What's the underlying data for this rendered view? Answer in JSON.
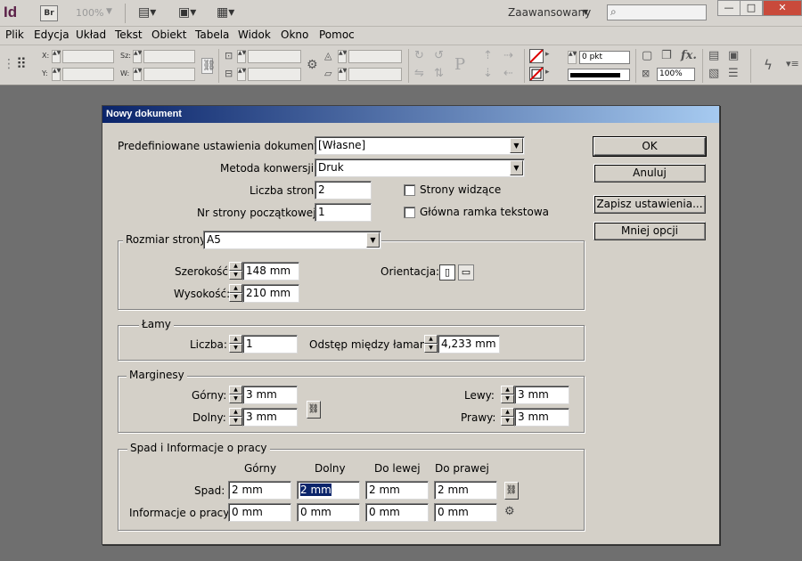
{
  "app": {
    "logo": "Id",
    "bridge": "Br",
    "zoom": "100%",
    "workspace": "Zaawansowany",
    "search_placeholder": "",
    "window_buttons": [
      "—",
      "□",
      "✕"
    ]
  },
  "menubar": [
    "Plik",
    "Edycja",
    "Układ",
    "Tekst",
    "Obiekt",
    "Tabela",
    "Widok",
    "Okno",
    "Pomoc"
  ],
  "control_panel": {
    "x_label": "X:",
    "y_label": "Y:",
    "w_label": "Sz:",
    "h_label": "W:",
    "stroke_weight": "0 pkt",
    "opacity": "100%"
  },
  "dialog": {
    "title": "Nowy dokument",
    "preset_label": "Predefiniowane ustawienia dokumentu:",
    "preset_value": "[Własne]",
    "conversion_label": "Metoda konwersji:",
    "conversion_value": "Druk",
    "pages_label": "Liczba stron:",
    "pages_value": "2",
    "start_page_label": "Nr strony początkowej:",
    "start_page_value": "1",
    "facing_pages_label": "Strony widzące",
    "master_frame_label": "Główna ramka tekstowa",
    "buttons": {
      "ok": "OK",
      "cancel": "Anuluj",
      "save": "Zapisz ustawienia...",
      "fewer": "Mniej opcji"
    },
    "page_size": {
      "label": "Rozmiar strony:",
      "value": "A5",
      "width_label": "Szerokość:",
      "width_value": "148 mm",
      "height_label": "Wysokość:",
      "height_value": "210 mm",
      "orientation_label": "Orientacja:"
    },
    "columns": {
      "title": "Łamy",
      "count_label": "Liczba:",
      "count_value": "1",
      "gutter_label": "Odstęp między łamami:",
      "gutter_value": "4,233 mm"
    },
    "margins": {
      "title": "Marginesy",
      "top_label": "Górny:",
      "top_value": "3 mm",
      "bottom_label": "Dolny:",
      "bottom_value": "3 mm",
      "left_label": "Lewy:",
      "left_value": "3 mm",
      "right_label": "Prawy:",
      "right_value": "3 mm"
    },
    "bleed": {
      "title": "Spad i Informacje o pracy",
      "col_top": "Górny",
      "col_bottom": "Dolny",
      "col_left": "Do lewej",
      "col_right": "Do prawej",
      "bleed_label": "Spad:",
      "bleed_values": [
        "2 mm",
        "2 mm",
        "2 mm",
        "2 mm"
      ],
      "slug_label": "Informacje o pracy:",
      "slug_values": [
        "0 mm",
        "0 mm",
        "0 mm",
        "0 mm"
      ]
    }
  }
}
